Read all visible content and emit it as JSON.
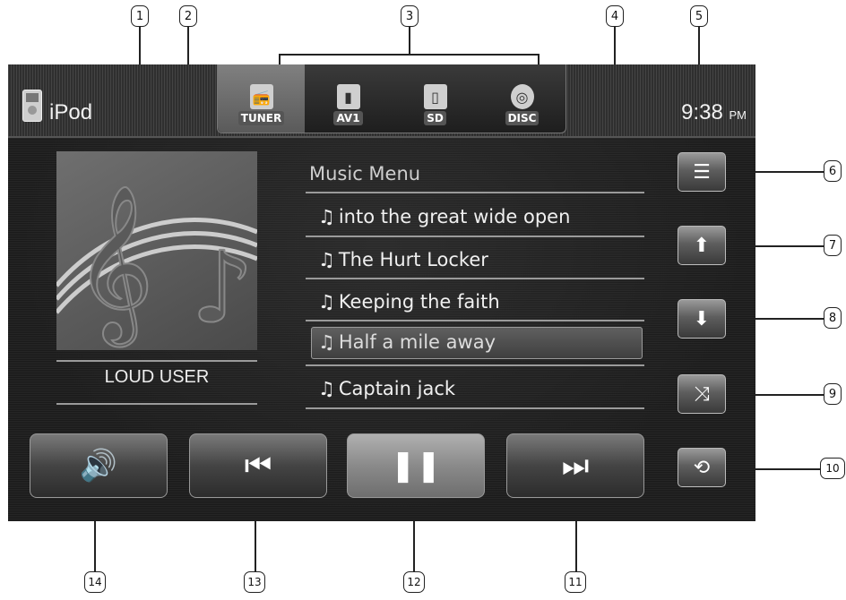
{
  "source": {
    "label": "iPod"
  },
  "clock": {
    "time": "9:38",
    "ampm": "PM"
  },
  "tabs": [
    {
      "label": "TUNER",
      "icon": "radio-icon",
      "active": true
    },
    {
      "label": "AV1",
      "icon": "av-input-icon",
      "active": false
    },
    {
      "label": "SD",
      "icon": "sd-card-icon",
      "active": false
    },
    {
      "label": "DISC",
      "icon": "disc-icon",
      "active": false
    }
  ],
  "album": {
    "icon": "music-note-art",
    "user_label": "LOUD  USER"
  },
  "menu": {
    "title": "Music Menu",
    "note_glyph": "♫",
    "songs": [
      "into the great wide open",
      "The Hurt Locker",
      "Keeping the faith",
      "Half a mile away",
      "Captain jack"
    ],
    "selected_index": 3
  },
  "side_buttons": [
    "list-icon",
    "arrow-up-icon",
    "arrow-down-icon",
    "shuffle-icon",
    "repeat-icon"
  ],
  "transport": [
    "volume-icon",
    "previous-icon",
    "pause-icon",
    "next-icon"
  ],
  "callouts": [
    "1",
    "2",
    "3",
    "4",
    "5",
    "6",
    "7",
    "8",
    "9",
    "10",
    "11",
    "12",
    "13",
    "14"
  ]
}
